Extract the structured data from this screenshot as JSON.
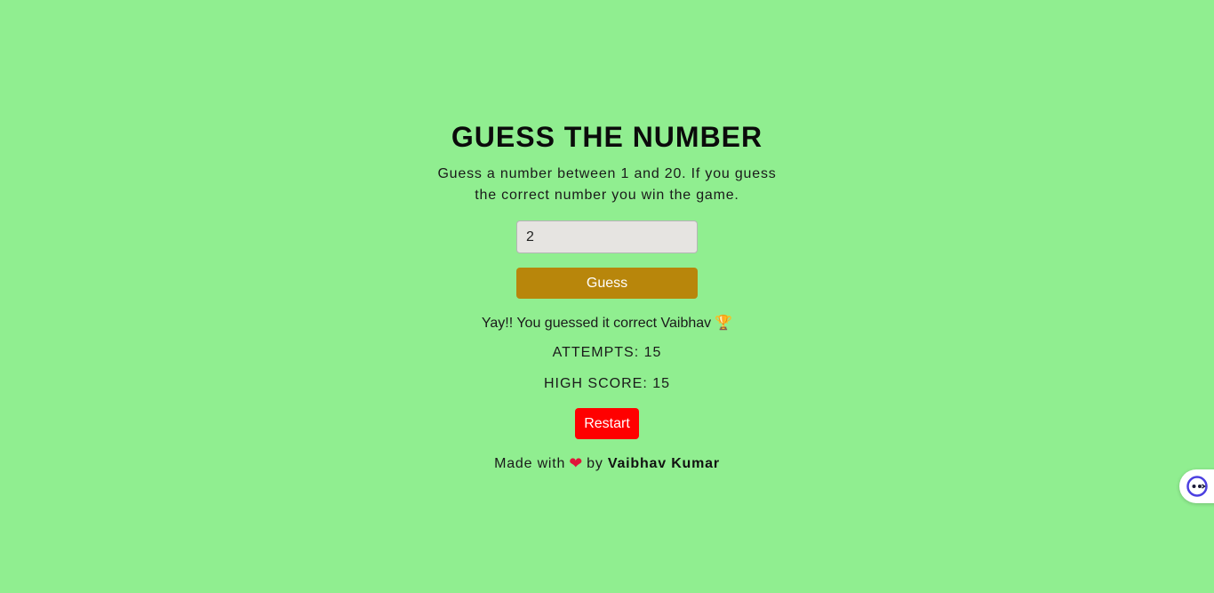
{
  "game": {
    "title": "GUESS THE NUMBER",
    "instructions": "Guess a number between 1 and 20. If you guess the correct number you win the game."
  },
  "input": {
    "value": "2",
    "placeholder": ""
  },
  "buttons": {
    "guess_label": "Guess",
    "restart_label": "Restart"
  },
  "status": {
    "message": "Yay!! You guessed it correct Vaibhav",
    "message_icon": "trophy-icon"
  },
  "stats": {
    "attempts": "ATTEMPTS: 15",
    "high_score": "HIGH SCORE: 15"
  },
  "footer": {
    "made_with": "Made with",
    "by": "by",
    "author": "Vaibhav Kumar",
    "icon": "heart-icon"
  },
  "widget": {
    "icon": "assistant-face-icon"
  },
  "colors": {
    "background": "#90ee90",
    "guess_button": "#b8860b",
    "restart_button": "#ff0000",
    "heart": "#e0153a"
  }
}
